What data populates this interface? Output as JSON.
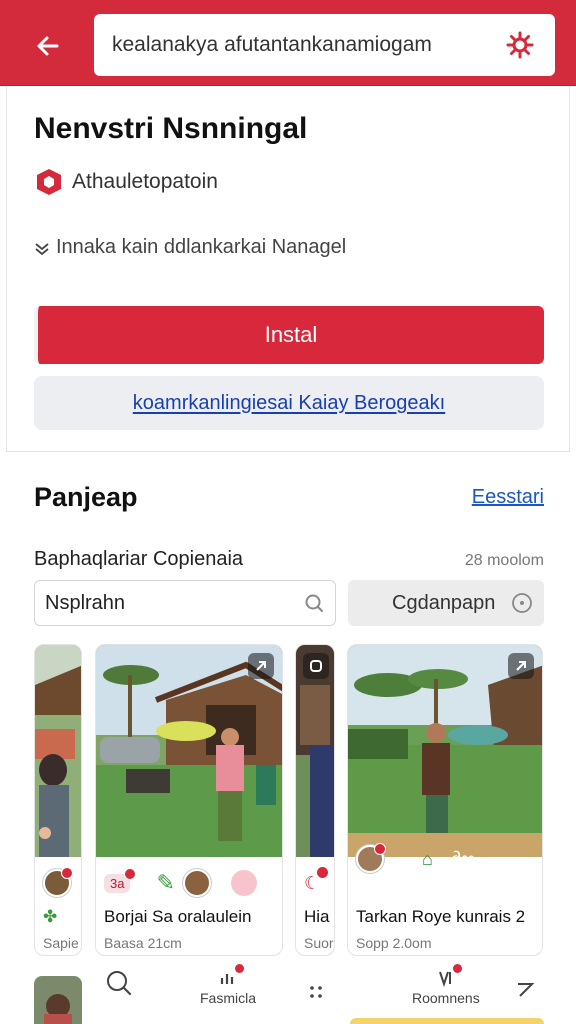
{
  "topbar": {
    "search_text": "kealanakya afutantankanamiogam",
    "back_icon": "arrow-left-icon",
    "gear_icon": "gear-icon",
    "color": "#d32a3c"
  },
  "app": {
    "title": "Nenvstri Nsnningal",
    "developer": "Athauletopatoin",
    "info": "Innaka  kain ddlankarkai Nanagel",
    "install_label": "Instal",
    "secondary_label": "koamrkanlingiesai Kaiay Berogeakı",
    "accent": "#d8283b"
  },
  "section": {
    "title": "Panjeap",
    "link": "Eesstari",
    "sub_label": "Baphaqlariar Copienaia",
    "sub_meta": "28 moolom",
    "filter_input": "Nsplrahn",
    "filter_select": "Cgdanpapn"
  },
  "cards": [
    {
      "title": "",
      "sub": "Sapie"
    },
    {
      "title": "Borjai Sa oralaulein",
      "sub": "Baasa 21cm",
      "badge": "3a"
    },
    {
      "title": "Hia",
      "sub": "Suor"
    },
    {
      "title": "Tarkan Roye kunrais 2",
      "sub": "Sopp 2.0om"
    }
  ],
  "nav": {
    "items": [
      {
        "label": "",
        "icon": "search-icon"
      },
      {
        "label": "Fasmicla",
        "icon": "chart-icon"
      },
      {
        "label": "",
        "icon": "grid-icon"
      },
      {
        "label": "Roomnens",
        "icon": "tv-icon"
      },
      {
        "label": "",
        "icon": "send-icon"
      }
    ]
  }
}
